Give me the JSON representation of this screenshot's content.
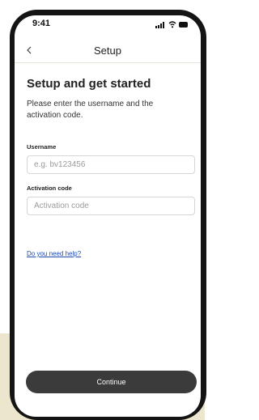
{
  "status_bar": {
    "time": "9:41"
  },
  "nav": {
    "title": "Setup"
  },
  "main": {
    "heading": "Setup and get started",
    "description": "Please enter the username and the activation code.",
    "username_label": "Username",
    "username_placeholder": "e.g. bv123456",
    "username_value": "",
    "activation_label": "Activation code",
    "activation_placeholder": "Activation code",
    "activation_value": "",
    "help_link": "Do you need help?",
    "continue_label": "Continue"
  },
  "colors": {
    "accent_button": "#3b3b3b",
    "link": "#1f4bb0",
    "background_panel": "#ece6cf"
  }
}
